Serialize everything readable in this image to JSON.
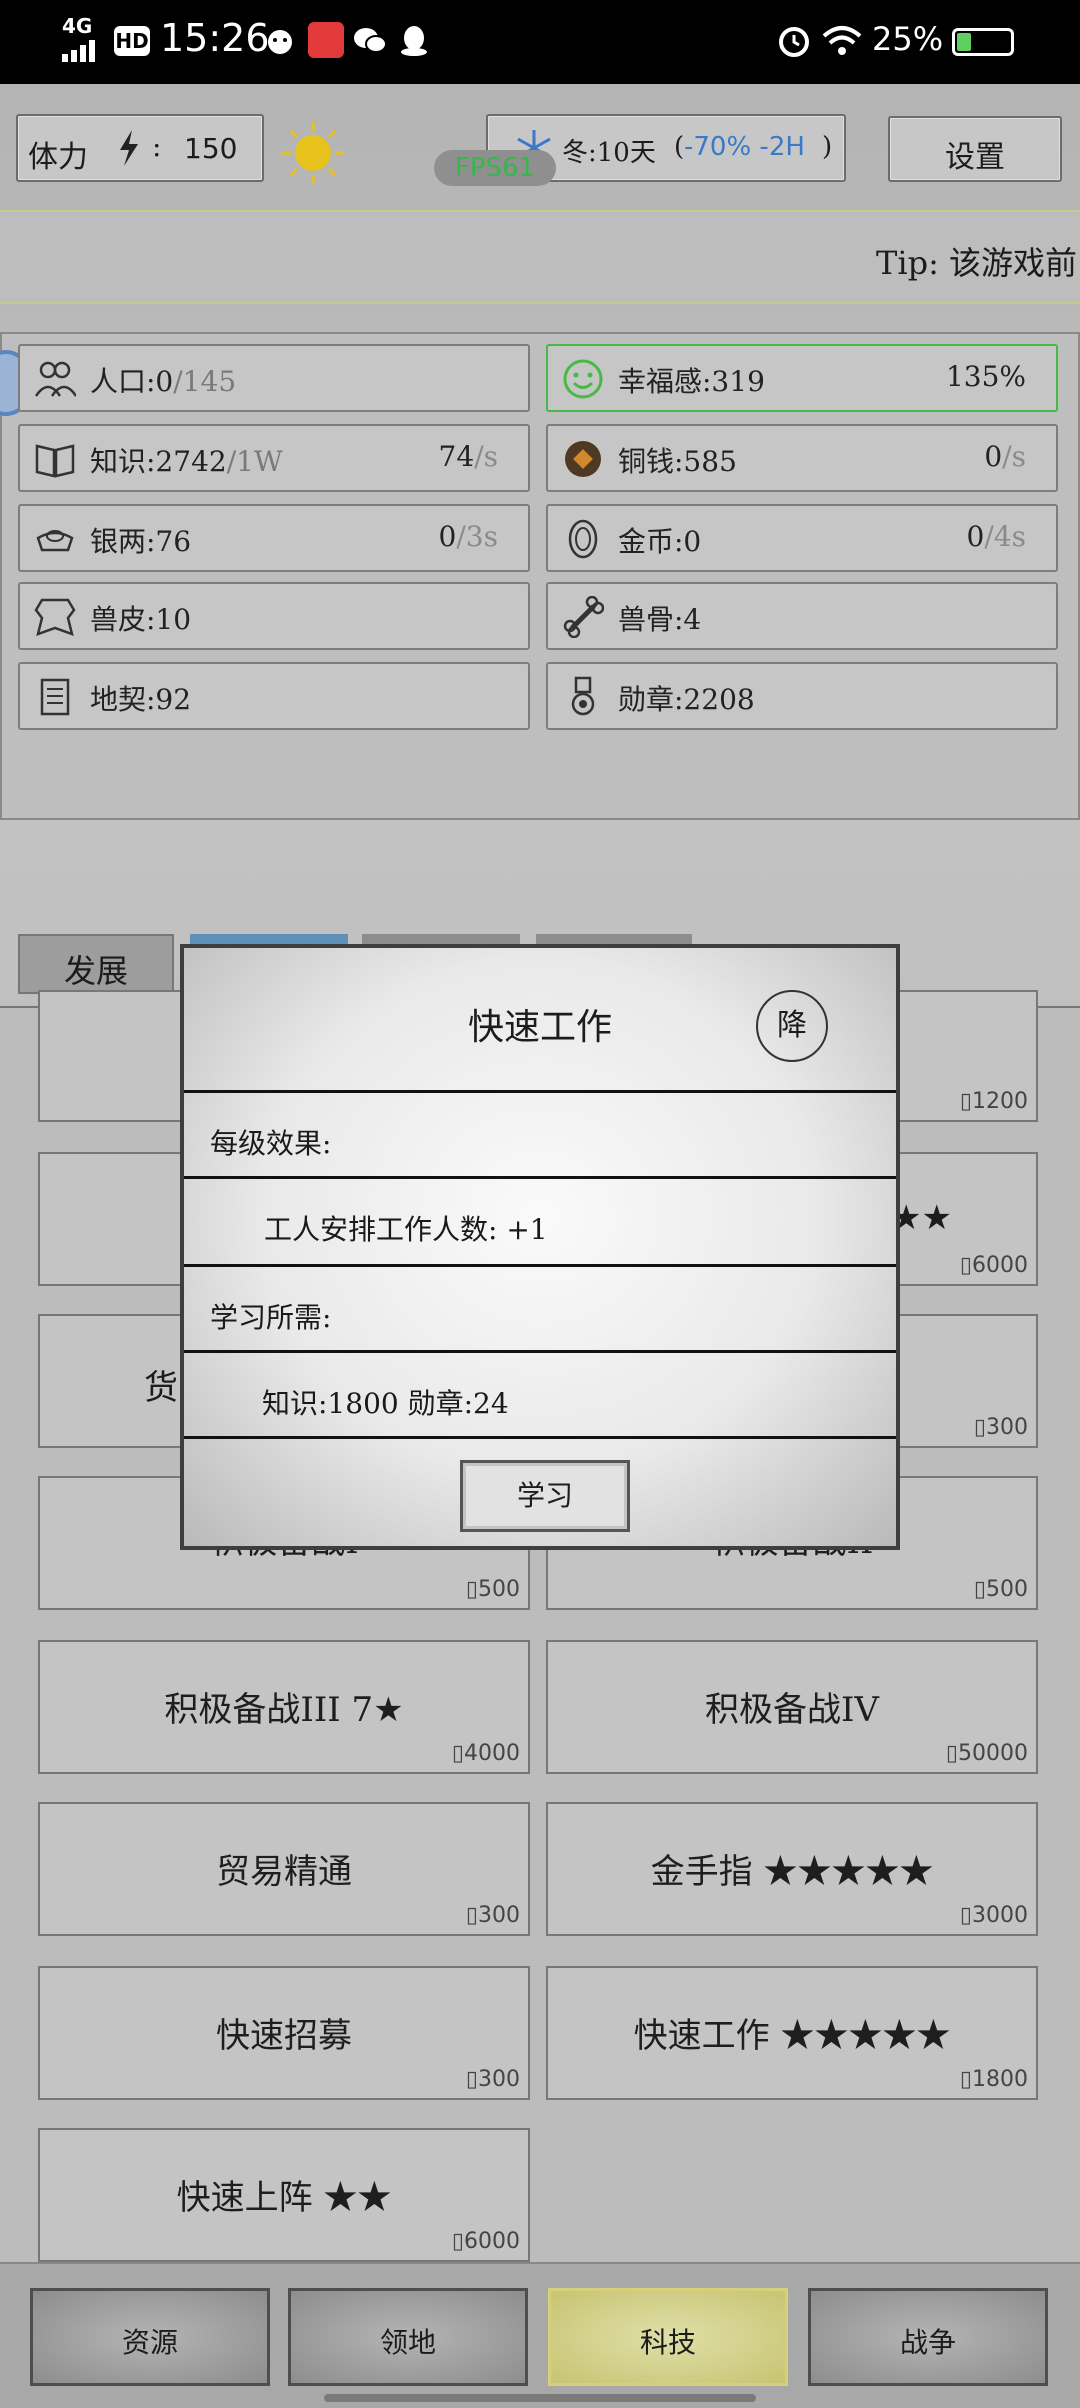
{
  "status_bar": {
    "network": "4G",
    "hd": "HD",
    "time": "15:26",
    "battery": "25%"
  },
  "top": {
    "stamina_label": "体力",
    "stamina_sep": ":",
    "stamina_value": "150",
    "season": "冬:10天",
    "season_paren_open": "(",
    "season_effect": "-70% -2H",
    "season_paren_close": ")",
    "fps": "FPS61",
    "settings": "设置",
    "tip": "Tip:  该游戏前"
  },
  "resources": [
    {
      "label": "人口:0",
      "dim": "/145",
      "rate": "",
      "rate_dim": "",
      "icon": "people-icon"
    },
    {
      "label": "幸福感:319",
      "dim": "",
      "rate": "135%",
      "rate_dim": "",
      "icon": "smiley-icon"
    },
    {
      "label": "知识:2742",
      "dim": "/1W",
      "rate": "74",
      "rate_dim": "/s",
      "icon": "book-icon"
    },
    {
      "label": "铜钱:585",
      "dim": "",
      "rate": "0",
      "rate_dim": "/s",
      "icon": "copper-coin-icon"
    },
    {
      "label": "银两:76",
      "dim": "",
      "rate": "0",
      "rate_dim": "/3s",
      "icon": "silver-ingot-icon"
    },
    {
      "label": "金币:0",
      "dim": "",
      "rate": "0",
      "rate_dim": "/4s",
      "icon": "gold-coin-icon"
    },
    {
      "label": "兽皮:10",
      "dim": "",
      "rate": "",
      "rate_dim": "",
      "icon": "hide-icon"
    },
    {
      "label": "兽骨:4",
      "dim": "",
      "rate": "",
      "rate_dim": "",
      "icon": "bone-icon"
    },
    {
      "label": "地契:92",
      "dim": "",
      "rate": "",
      "rate_dim": "",
      "icon": "deed-icon"
    },
    {
      "label": "勋章:2208",
      "dim": "",
      "rate": "",
      "rate_dim": "",
      "icon": "medal-icon"
    }
  ],
  "tabs": {
    "develop": "发展"
  },
  "tech": [
    {
      "name": "",
      "cost": "1200"
    },
    {
      "name": "",
      "cost": "6000"
    },
    {
      "name": "货",
      "cost": ""
    },
    {
      "name": "",
      "cost": "300"
    },
    {
      "name": "积极备战I",
      "cost": "500"
    },
    {
      "name": "积极备战II",
      "cost": "500"
    },
    {
      "name": "积极备战III  7★",
      "cost": "4000"
    },
    {
      "name": "积极备战IV",
      "cost": "50000"
    },
    {
      "name": "贸易精通",
      "cost": "300"
    },
    {
      "name": "金手指 ★★★★★",
      "cost": "3000"
    },
    {
      "name": "快速招募",
      "cost": "300"
    },
    {
      "name": "快速工作 ★★★★★",
      "cost": "1800"
    },
    {
      "name": "快速上阵 ★★",
      "cost": "6000"
    }
  ],
  "peek_stars": "★★",
  "modal": {
    "title": "快速工作",
    "downgrade": "降",
    "effect_header": "每级效果:",
    "effect_text": "工人安排工作人数: +1",
    "req_header": "学习所需:",
    "req_text": "知识:1800    勋章:24",
    "learn": "学习"
  },
  "nav": [
    "资源",
    "领地",
    "科技",
    "战争"
  ],
  "colors": {
    "accent_blue": "#3a78c8",
    "fps_green": "#39b54a",
    "happy_green": "#46b946",
    "nav_active": "#e9e38a"
  }
}
